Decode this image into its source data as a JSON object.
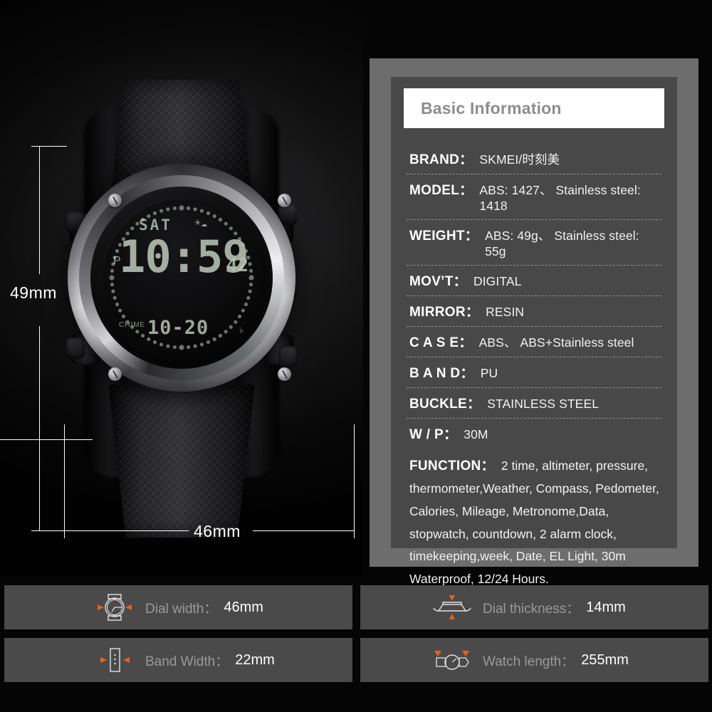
{
  "product_photo": {
    "alt": "SKMEI digital sports watch front view",
    "dimensions": {
      "height_label": "49mm",
      "width_label": "46mm"
    },
    "watch_display": {
      "day": "SAT",
      "time": "10:59",
      "seconds": "42",
      "mode_indicator": "P",
      "chime_label": "CHIME",
      "date": "10-20",
      "weather_icon": "sun-cloud-icon",
      "alarm_icon": "bell-icon"
    }
  },
  "spec_card": {
    "title": "Basic Information",
    "rows": [
      {
        "label": "BRAND：",
        "value": "SKMEI/时刻美"
      },
      {
        "label": "MODEL：",
        "value": "ABS: 1427、 Stainless steel: 1418"
      },
      {
        "label": "WEIGHT：",
        "value": "ABS: 49g、 Stainless steel: 55g"
      },
      {
        "label": "MOV’T：",
        "value": "DIGITAL"
      },
      {
        "label": "MIRROR：",
        "value": "RESIN"
      },
      {
        "label": "C A S E：",
        "value": "ABS、 ABS+Stainless steel"
      },
      {
        "label": "B A N D：",
        "value": "PU"
      },
      {
        "label": "BUCKLE：",
        "value": "STAINLESS STEEL"
      },
      {
        "label": "W / P：",
        "value": "30M"
      }
    ],
    "function_row": {
      "label": "FUNCTION：",
      "value": "2 time, altimeter, pressure, thermometer,Weather, Compass, Pedometer, Calories, Mileage, Metronome,Data, stopwatch, countdown, 2 alarm clock, timekeeping,week, Date, EL Light, 30m Waterproof, 12/24 Hours."
    }
  },
  "info_bars": [
    {
      "icon": "watch-dial-width-icon",
      "label": "Dial width：",
      "value": "46mm"
    },
    {
      "icon": "watch-thickness-icon",
      "label": "Dial thickness：",
      "value": "14mm"
    },
    {
      "icon": "band-width-icon",
      "label": "Band Width：",
      "value": "22mm"
    },
    {
      "icon": "watch-length-icon",
      "label": "Watch length：",
      "value": "255mm"
    }
  ],
  "colors": {
    "background": "#000000",
    "card_frame": "#6d6d6d",
    "card_body": "#484848",
    "title_bar": "#ffffff",
    "title_text": "#8d8d8d",
    "bar_background": "#4a4a4a",
    "accent_orange": "#e8621e",
    "label_gray": "#9a9a9a",
    "lcd_green": "#b9c4b4"
  }
}
